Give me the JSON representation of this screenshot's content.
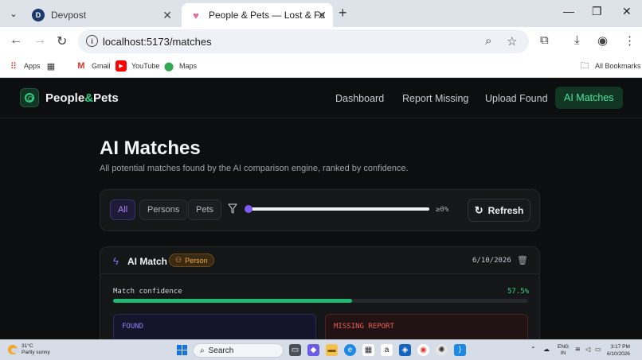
{
  "browser": {
    "tabs": [
      {
        "title": "Devpost",
        "favicon": "D"
      },
      {
        "title": "People & Pets — Lost & Found Registry",
        "favicon": "♥"
      }
    ],
    "url": "localhost:5173/matches",
    "bookmarks": [
      {
        "label": "Apps"
      },
      {
        "label": "Gmail"
      },
      {
        "label": "YouTube"
      },
      {
        "label": "Maps"
      }
    ],
    "all_bookmarks": "All Bookmarks"
  },
  "app": {
    "brand": {
      "part1": "People",
      "amp": "&",
      "part2": "Pets"
    },
    "nav": [
      {
        "label": "Dashboard"
      },
      {
        "label": "Report Missing"
      },
      {
        "label": "Upload Found"
      },
      {
        "label": "AI Matches",
        "active": true
      }
    ],
    "page": {
      "title": "AI Matches",
      "subtitle": "All potential matches found by the AI comparison engine, ranked by confidence."
    },
    "filters": {
      "chips": [
        {
          "label": "All",
          "active": true
        },
        {
          "label": "Persons"
        },
        {
          "label": "Pets"
        }
      ],
      "min_confidence": 0,
      "min_confidence_label": "≥0%",
      "refresh_label": "Refresh"
    },
    "match": {
      "title": "AI Match",
      "badge": "Person",
      "date": "6/10/2026",
      "confidence_label": "Match confidence",
      "confidence_value": "57.5%",
      "confidence_fraction": 0.575,
      "found_label": "FOUND",
      "missing_label": "MISSING REPORT"
    }
  },
  "taskbar": {
    "weather_temp": "31°C",
    "weather_desc": "Partly sunny",
    "search_label": "Search",
    "lang1": "ENG",
    "lang2": "IN",
    "time": "3:17 PM",
    "date": "6/10/2026"
  },
  "colors": {
    "accent_green": "#2bd07f",
    "accent_purple": "#7c5cf5",
    "background": "#0d0e0f"
  }
}
